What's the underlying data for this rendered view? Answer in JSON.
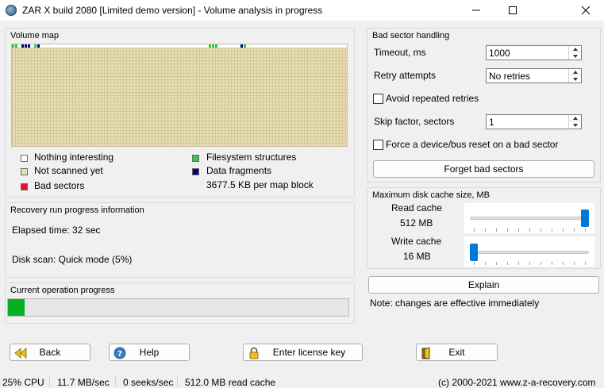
{
  "window": {
    "title": "ZAR X build 2080 [Limited demo version] - Volume analysis in progress"
  },
  "volume_map": {
    "title": "Volume map",
    "legend": {
      "nothing": "Nothing interesting",
      "not_scanned": "Not scanned yet",
      "bad": "Bad sectors",
      "filesystem": "Filesystem structures",
      "fragments": "Data fragments",
      "block_info": "3677.5 KB per map block"
    },
    "colors": {
      "nothing": "#ffffff",
      "not_scanned": "#e9ddb4",
      "bad": "#e81123",
      "filesystem": "#2ecc40",
      "fragments": "#000080"
    }
  },
  "recovery_info": {
    "title": "Recovery run progress information",
    "elapsed": "Elapsed time: 32 sec",
    "disk_scan": "Disk scan: Quick mode (5%)"
  },
  "current_operation": {
    "title": "Current operation progress",
    "progress": 0.05
  },
  "bad_sector": {
    "title": "Bad sector handling",
    "timeout_label": "Timeout, ms",
    "timeout_value": "1000",
    "retry_label": "Retry attempts",
    "retry_value": "No retries",
    "avoid_label": "Avoid repeated retries",
    "skip_label": "Skip factor, sectors",
    "skip_value": "1",
    "reset_label": "Force a device/bus reset on a bad sector",
    "forget_button": "Forget bad sectors"
  },
  "cache": {
    "title": "Maximum disk cache size, MB",
    "read_label": "Read cache",
    "read_value": "512 MB",
    "read_level": 1.0,
    "write_label": "Write cache",
    "write_value": "16 MB",
    "write_level": 0.0,
    "explain_button": "Explain",
    "note": "Note: changes are effective immediately"
  },
  "buttons": {
    "back": "Back",
    "help": "Help",
    "license": "Enter license key",
    "exit": "Exit"
  },
  "statusbar": {
    "cpu": "25% CPU",
    "speed": "11.7 MB/sec",
    "seeks": "0 seeks/sec",
    "read_cache": "512.0 MB read cache",
    "copyright": "(c) 2000-2021 www.z-a-recovery.com"
  }
}
